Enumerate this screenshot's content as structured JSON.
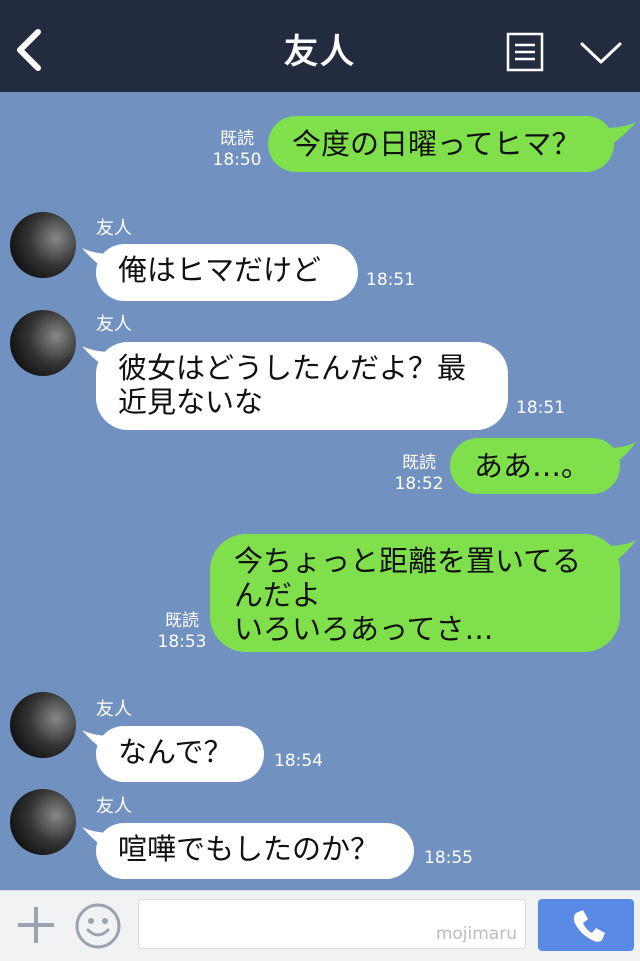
{
  "header": {
    "title": "友人"
  },
  "read_label": "既読",
  "messages": [
    {
      "side": "right",
      "text": "今度の日曜ってヒマ？",
      "time": "18:50"
    },
    {
      "side": "left",
      "sender": "友人",
      "text": "俺はヒマだけど",
      "time": "18:51"
    },
    {
      "side": "left",
      "sender": "友人",
      "lines": [
        "彼女はどうしたんだよ？最",
        "近見ないな"
      ],
      "time": "18:51"
    },
    {
      "side": "right",
      "text": "ああ…。",
      "time": "18:52"
    },
    {
      "side": "right",
      "lines": [
        "今ちょっと距離を置いてる",
        "んだよ",
        "いろいろあってさ…"
      ],
      "time": "18:53"
    },
    {
      "side": "left",
      "sender": "友人",
      "text": "なんで？",
      "time": "18:54"
    },
    {
      "side": "left",
      "sender": "友人",
      "text": "喧嘩でもしたのか？",
      "time": "18:55"
    }
  ],
  "input": {
    "watermark": "mojimaru"
  },
  "icons": {
    "back": "chevron-left-icon",
    "menu": "notes-icon",
    "collapse": "chevron-down-icon",
    "plus": "plus-icon",
    "emoji": "smiley-icon",
    "call": "phone-icon"
  },
  "colors": {
    "header_bg": "#232b3f",
    "chat_bg": "#7192c0",
    "right_bubble": "#80e04c",
    "left_bubble": "#ffffff",
    "call_button": "#5a8ae6"
  }
}
